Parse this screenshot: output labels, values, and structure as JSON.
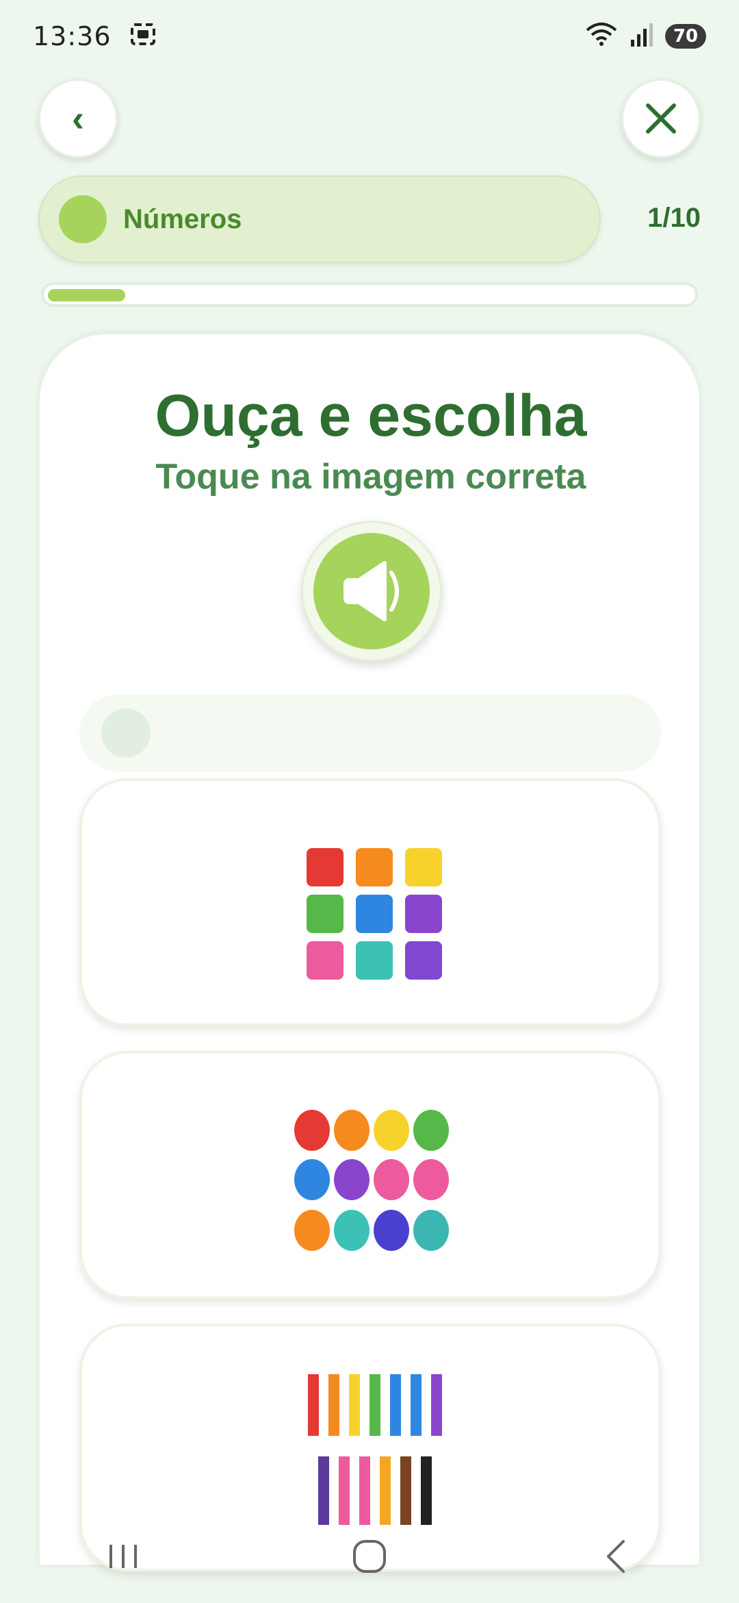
{
  "status_bar": {
    "time": "13:36",
    "battery": "70"
  },
  "header": {
    "back_label": "‹",
    "category_label": "Números",
    "progress_text": "1/10",
    "progress_fraction": 0.12
  },
  "main": {
    "title": "Ouça e escolha",
    "subtitle": "Toque na imagem correta"
  },
  "options": [
    {
      "name": "blocks"
    },
    {
      "name": "balloons"
    },
    {
      "name": "pencils"
    }
  ],
  "colors": {
    "accent_green": "#a6d35b",
    "dark_green": "#2f6e31",
    "background": "#eef7ee"
  },
  "icons": {
    "back": "back-chevron-icon",
    "close": "close-icon",
    "audio": "speaker-icon"
  }
}
